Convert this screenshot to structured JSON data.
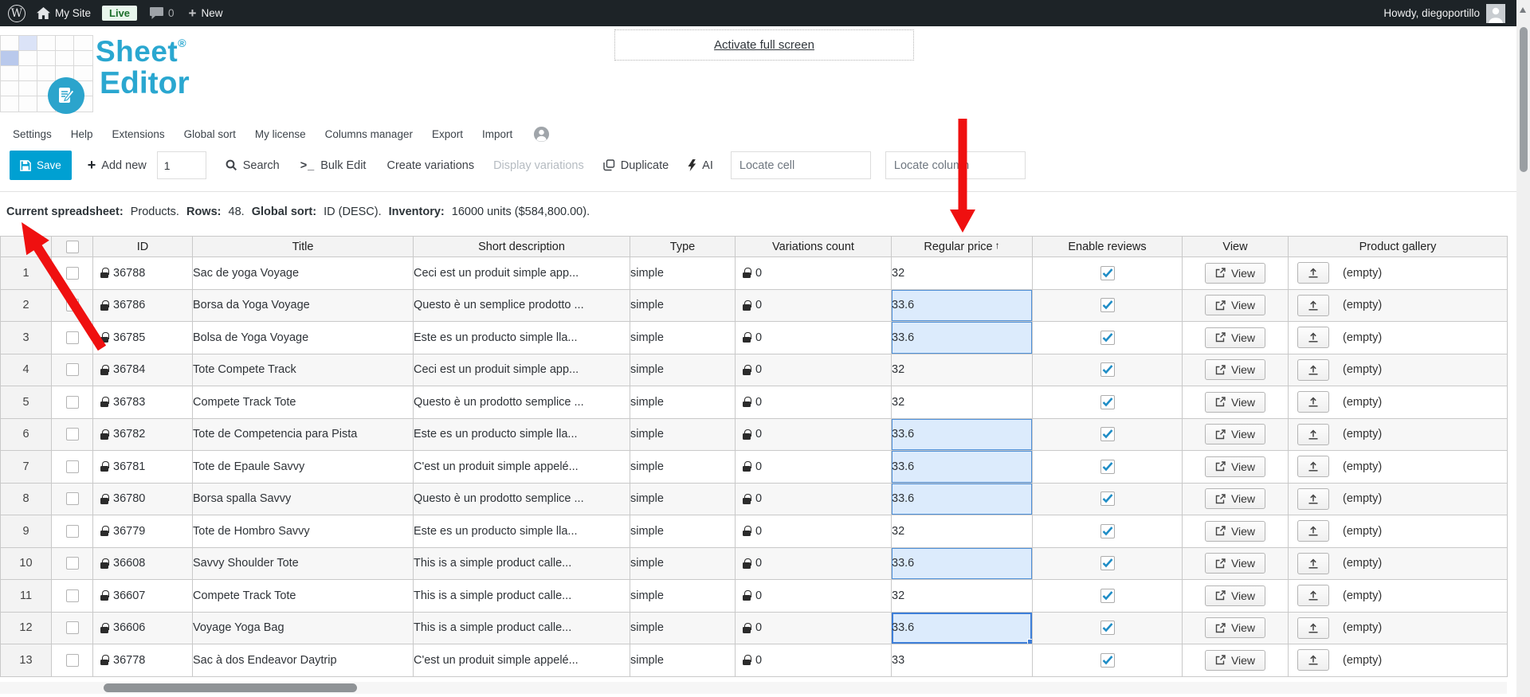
{
  "admin_bar": {
    "site_name": "My Site",
    "live_badge": "Live",
    "comment_count": "0",
    "new_label": "New",
    "howdy": "Howdy, diegoportillo"
  },
  "header": {
    "fullscreen_link": "Activate full screen",
    "logo_word1": "Sheet",
    "logo_reg": "®",
    "logo_word2": "Editor"
  },
  "menu": {
    "items": [
      "Settings",
      "Help",
      "Extensions",
      "Global sort",
      "My license",
      "Columns manager",
      "Export",
      "Import"
    ]
  },
  "toolbar": {
    "save_label": "Save",
    "add_new_label": "Add new",
    "add_new_value": "1",
    "search_label": "Search",
    "bulk_edit_prefix": ">_",
    "bulk_edit_label": "Bulk Edit",
    "create_variations_label": "Create variations",
    "display_variations_label": "Display variations",
    "duplicate_label": "Duplicate",
    "ai_label": "AI",
    "locate_cell_placeholder": "Locate cell",
    "locate_column_placeholder": "Locate column"
  },
  "status": {
    "spreadsheet_label": "Current spreadsheet:",
    "spreadsheet_value": "Products.",
    "rows_label": "Rows:",
    "rows_value": "48.",
    "sort_label": "Global sort:",
    "sort_value": "ID (DESC).",
    "inventory_label": "Inventory:",
    "inventory_value": "16000 units ($584,800.00)."
  },
  "table": {
    "columns": [
      "ID",
      "Title",
      "Short description",
      "Type",
      "Variations count",
      "Regular price",
      "Enable reviews",
      "View",
      "Product gallery"
    ],
    "sort_indicator": "↑",
    "rows": [
      {
        "num": "1",
        "id": "36788",
        "title": "Sac de yoga Voyage",
        "description": "Ceci est un produit simple app...",
        "type": "simple",
        "variations": "0",
        "price": "32",
        "price_selected": false,
        "price_active": false,
        "reviews_checked": true,
        "view_label": "View",
        "gallery_label": "(empty)"
      },
      {
        "num": "2",
        "id": "36786",
        "title": "Borsa da Yoga Voyage",
        "description": "Questo è un semplice prodotto ...",
        "type": "simple",
        "variations": "0",
        "price": "33.6",
        "price_selected": true,
        "price_active": false,
        "reviews_checked": true,
        "view_label": "View",
        "gallery_label": "(empty)"
      },
      {
        "num": "3",
        "id": "36785",
        "title": "Bolsa de Yoga Voyage",
        "description": "Este es un producto simple lla...",
        "type": "simple",
        "variations": "0",
        "price": "33.6",
        "price_selected": true,
        "price_active": false,
        "reviews_checked": true,
        "view_label": "View",
        "gallery_label": "(empty)"
      },
      {
        "num": "4",
        "id": "36784",
        "title": "Tote Compete Track",
        "description": "Ceci est un produit simple app...",
        "type": "simple",
        "variations": "0",
        "price": "32",
        "price_selected": false,
        "price_active": false,
        "reviews_checked": true,
        "view_label": "View",
        "gallery_label": "(empty)"
      },
      {
        "num": "5",
        "id": "36783",
        "title": "Compete Track Tote",
        "description": "Questo è un prodotto semplice ...",
        "type": "simple",
        "variations": "0",
        "price": "32",
        "price_selected": false,
        "price_active": false,
        "reviews_checked": true,
        "view_label": "View",
        "gallery_label": "(empty)"
      },
      {
        "num": "6",
        "id": "36782",
        "title": "Tote de Competencia para Pista",
        "description": "Este es un producto simple lla...",
        "type": "simple",
        "variations": "0",
        "price": "33.6",
        "price_selected": true,
        "price_active": false,
        "reviews_checked": true,
        "view_label": "View",
        "gallery_label": "(empty)"
      },
      {
        "num": "7",
        "id": "36781",
        "title": "Tote de Epaule Savvy",
        "description": "C'est un produit simple appelé...",
        "type": "simple",
        "variations": "0",
        "price": "33.6",
        "price_selected": true,
        "price_active": false,
        "reviews_checked": true,
        "view_label": "View",
        "gallery_label": "(empty)"
      },
      {
        "num": "8",
        "id": "36780",
        "title": "Borsa spalla Savvy",
        "description": "Questo è un prodotto semplice ...",
        "type": "simple",
        "variations": "0",
        "price": "33.6",
        "price_selected": true,
        "price_active": false,
        "reviews_checked": true,
        "view_label": "View",
        "gallery_label": "(empty)"
      },
      {
        "num": "9",
        "id": "36779",
        "title": "Tote de Hombro Savvy",
        "description": "Este es un producto simple lla...",
        "type": "simple",
        "variations": "0",
        "price": "32",
        "price_selected": false,
        "price_active": false,
        "reviews_checked": true,
        "view_label": "View",
        "gallery_label": "(empty)"
      },
      {
        "num": "10",
        "id": "36608",
        "title": "Savvy Shoulder Tote",
        "description": "This is a simple product calle...",
        "type": "simple",
        "variations": "0",
        "price": "33.6",
        "price_selected": true,
        "price_active": false,
        "reviews_checked": true,
        "view_label": "View",
        "gallery_label": "(empty)"
      },
      {
        "num": "11",
        "id": "36607",
        "title": "Compete Track Tote",
        "description": "This is a simple product calle...",
        "type": "simple",
        "variations": "0",
        "price": "32",
        "price_selected": false,
        "price_active": false,
        "reviews_checked": true,
        "view_label": "View",
        "gallery_label": "(empty)"
      },
      {
        "num": "12",
        "id": "36606",
        "title": "Voyage Yoga Bag",
        "description": "This is a simple product calle...",
        "type": "simple",
        "variations": "0",
        "price": "33.6",
        "price_selected": true,
        "price_active": true,
        "reviews_checked": true,
        "view_label": "View",
        "gallery_label": "(empty)"
      },
      {
        "num": "13",
        "id": "36778",
        "title": "Sac à dos Endeavor Daytrip",
        "description": "C'est un produit simple appelé...",
        "type": "simple",
        "variations": "0",
        "price": "33",
        "price_selected": false,
        "price_active": false,
        "reviews_checked": true,
        "view_label": "View",
        "gallery_label": "(empty)"
      }
    ]
  },
  "colors": {
    "admin_bar_bg": "#1d2327",
    "accent_blue": "#00a0d2",
    "logo_blue": "#2aa7d0",
    "selection_fill": "#dcebfc",
    "selection_border": "#4e90d9",
    "active_cell_border": "#3d7ed8",
    "arrow_red": "#ef1010",
    "live_badge_green": "#1d6f2c"
  }
}
